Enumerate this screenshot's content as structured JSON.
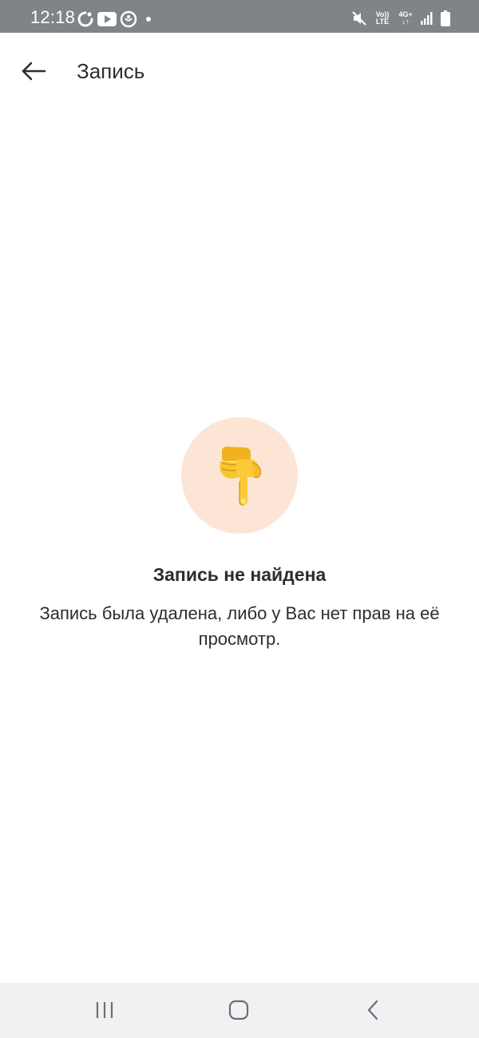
{
  "status_bar": {
    "time": "12:18",
    "left_icons": [
      "sync-icon",
      "youtube-icon",
      "vk-clips-icon",
      "notification-dot-icon"
    ],
    "right_icons": [
      "mute-icon",
      "volte-icon",
      "4g-plus-icon",
      "signal-icon",
      "battery-icon"
    ],
    "volte_top": "Vo))",
    "volte_bottom": "LTE",
    "net_top": "4G+",
    "net_bottom": "↓↑"
  },
  "app_bar": {
    "back_icon": "arrow-left-icon",
    "title": "Запись"
  },
  "empty_state": {
    "icon": "pointing-down-hand-emoji",
    "title": "Запись не найдена",
    "description": "Запись была удалена, либо у Вас нет прав на её просмотр."
  },
  "nav_bar": {
    "items": [
      "recents-icon",
      "home-icon",
      "back-icon"
    ]
  },
  "colors": {
    "status_bar_bg": "#808488",
    "emoji_circle_bg": "#fde5d6",
    "text_primary": "#2c2d2e",
    "nav_bar_bg": "#f1f1f3"
  }
}
